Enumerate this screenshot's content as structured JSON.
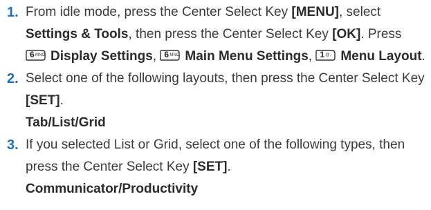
{
  "steps": [
    {
      "number": "1.",
      "t1": "From idle mode, press the Center Select Key ",
      "b1": "[MENU]",
      "t2": ", select ",
      "b2": "Settings & Tools",
      "t3": ", then press the Center Select Key ",
      "b3": "[OK]",
      "t4": ". Press ",
      "key1": {
        "digit": "6",
        "letters": "MNO",
        "icon": "key-6-icon"
      },
      "b4": "Display Settings",
      "t5": ", ",
      "key2": {
        "digit": "6",
        "letters": "MNO",
        "icon": "key-6-icon"
      },
      "b5": "Main Menu Settings",
      "t6": ", ",
      "key3": {
        "digit": "1",
        "letters": "@.-",
        "icon": "key-1-icon"
      },
      "b6": "Menu Layout",
      "t7": "."
    },
    {
      "number": "2.",
      "t1": "Select one of the following layouts, then press the Center Select Key ",
      "b1": "[SET]",
      "t2": ".",
      "options": "Tab/List/Grid"
    },
    {
      "number": "3.",
      "t1": "If you selected List or Grid, select one of the following types, then press the Center Select Key ",
      "b1": "[SET]",
      "t2": ".",
      "options": "Communicator/Productivity"
    }
  ],
  "colors": {
    "step_number": "#1f6fbf",
    "text": "#3a3a3a"
  }
}
